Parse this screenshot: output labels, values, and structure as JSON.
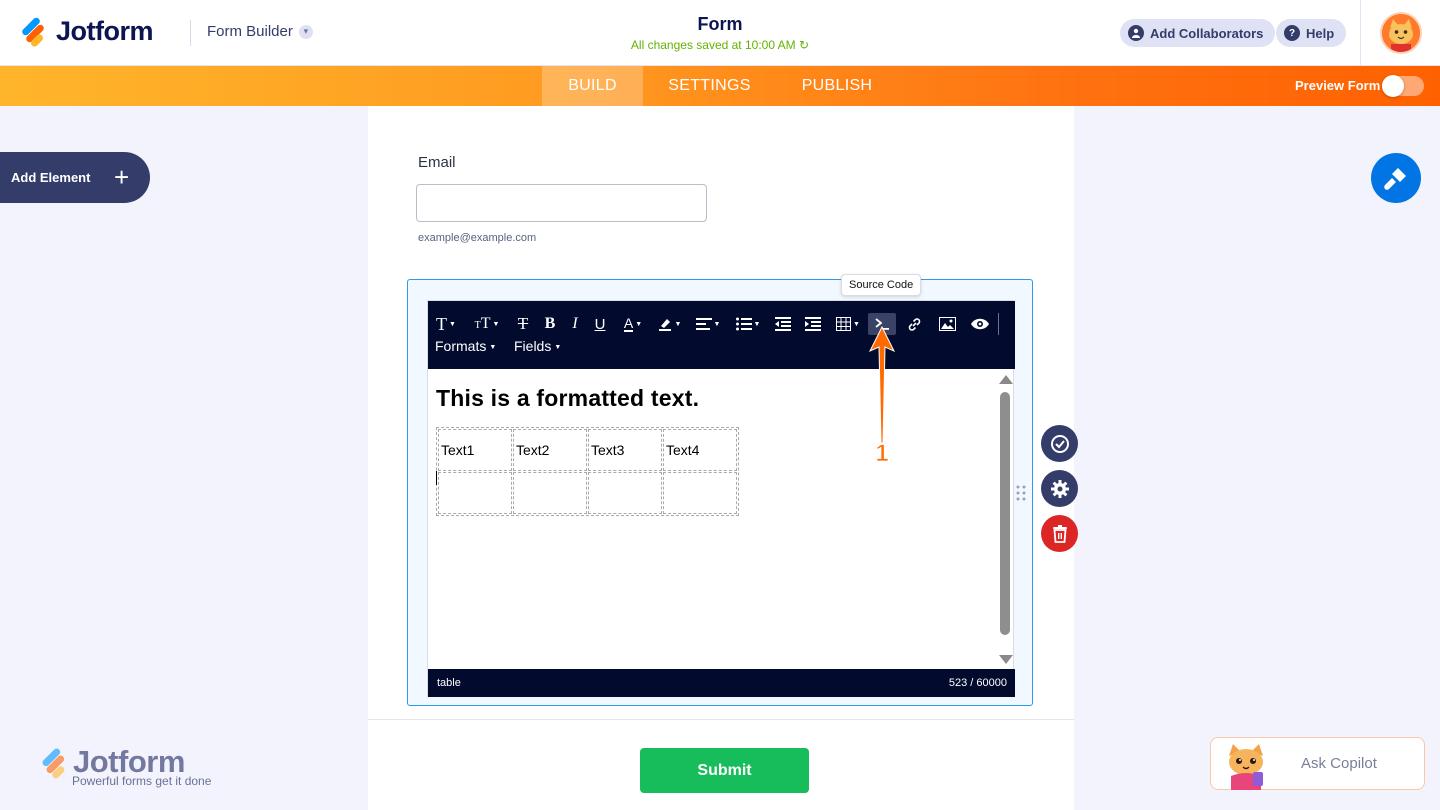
{
  "header": {
    "logo_text": "Jotform",
    "builder_label": "Form Builder",
    "form_title": "Form",
    "save_status": "All changes saved at 10:00 AM",
    "collaborators_label": "Add Collaborators",
    "help_label": "Help"
  },
  "nav": {
    "tabs": [
      {
        "label": "BUILD",
        "active": true
      },
      {
        "label": "SETTINGS",
        "active": false
      },
      {
        "label": "PUBLISH",
        "active": false
      }
    ],
    "preview_label": "Preview Form",
    "preview_on": false
  },
  "left_panel": {
    "add_element_label": "Add Element"
  },
  "form": {
    "email": {
      "label": "Email",
      "value": "",
      "sublabel": "example@example.com"
    },
    "submit_label": "Submit"
  },
  "editor": {
    "tooltip": "Source Code",
    "toolbar_row2": {
      "formats": "Formats",
      "fields": "Fields"
    },
    "heading": "This is a formatted text.",
    "table": [
      [
        "Text1",
        "Text2",
        "Text3",
        "Text4"
      ],
      [
        "",
        "",
        "",
        ""
      ]
    ],
    "status_path": "table",
    "char_count": "523 / 60000"
  },
  "annotation": {
    "step_number": "1",
    "color": "#ff6b00"
  },
  "watermark": {
    "text": "Jotform",
    "tagline": "Powerful forms get it done"
  },
  "copilot": {
    "label": "Ask Copilot"
  },
  "colors": {
    "brand_navy": "#0a1551",
    "accent_orange": "#ff6100",
    "accent_blue": "#0075e3",
    "submit_green": "#18bd5b",
    "delete_red": "#dc2626"
  }
}
